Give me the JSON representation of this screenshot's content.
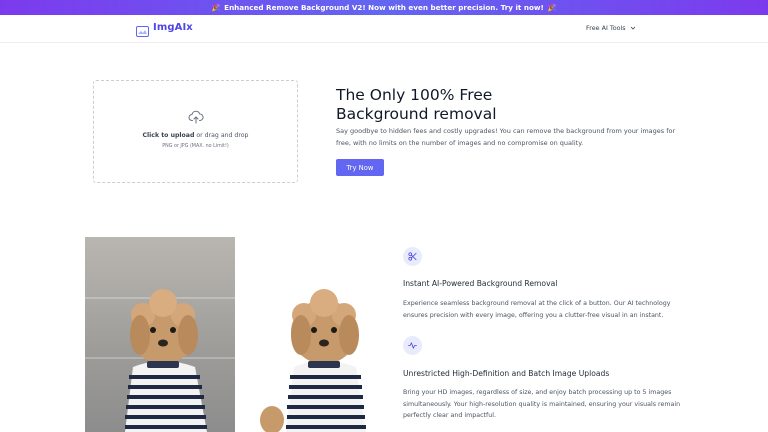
{
  "banner": {
    "emoji_left": "🎉",
    "text": "Enhanced Remove Background V2! Now with even better precision. Try it now!",
    "emoji_right": "🎉"
  },
  "nav": {
    "logo_text": "ImgAIx",
    "tools_label": "Free AI Tools"
  },
  "upload": {
    "click_label": "Click to upload",
    "drag_label": " or drag and drop",
    "hint": "PNG or JPG (MAX. no Limit!)"
  },
  "hero": {
    "title_line1": "The Only 100% Free",
    "title_line2": "Background removal",
    "description": "Say goodbye to hidden fees and costly upgrades! You can remove the background from your images for free, with no limits on the number of images and no compromise on quality.",
    "cta": "Try Now"
  },
  "features": [
    {
      "icon": "scissors-icon",
      "title": "Instant AI-Powered Background Removal",
      "description": "Experience seamless background removal at the click of a button. Our AI technology ensures precision with every image, offering you a clutter-free visual in an instant."
    },
    {
      "icon": "activity-icon",
      "title": "Unrestricted High-Definition and Batch Image Uploads",
      "description": "Bring your HD images, regardless of size, and enjoy batch processing up to 5 images simultaneously. Your high-resolution quality is maintained, ensuring your visuals remain perfectly clear and impactful."
    }
  ],
  "colors": {
    "accent": "#6366f1",
    "banner": "#7c3aed",
    "icon_bg": "#e8ebfb"
  }
}
